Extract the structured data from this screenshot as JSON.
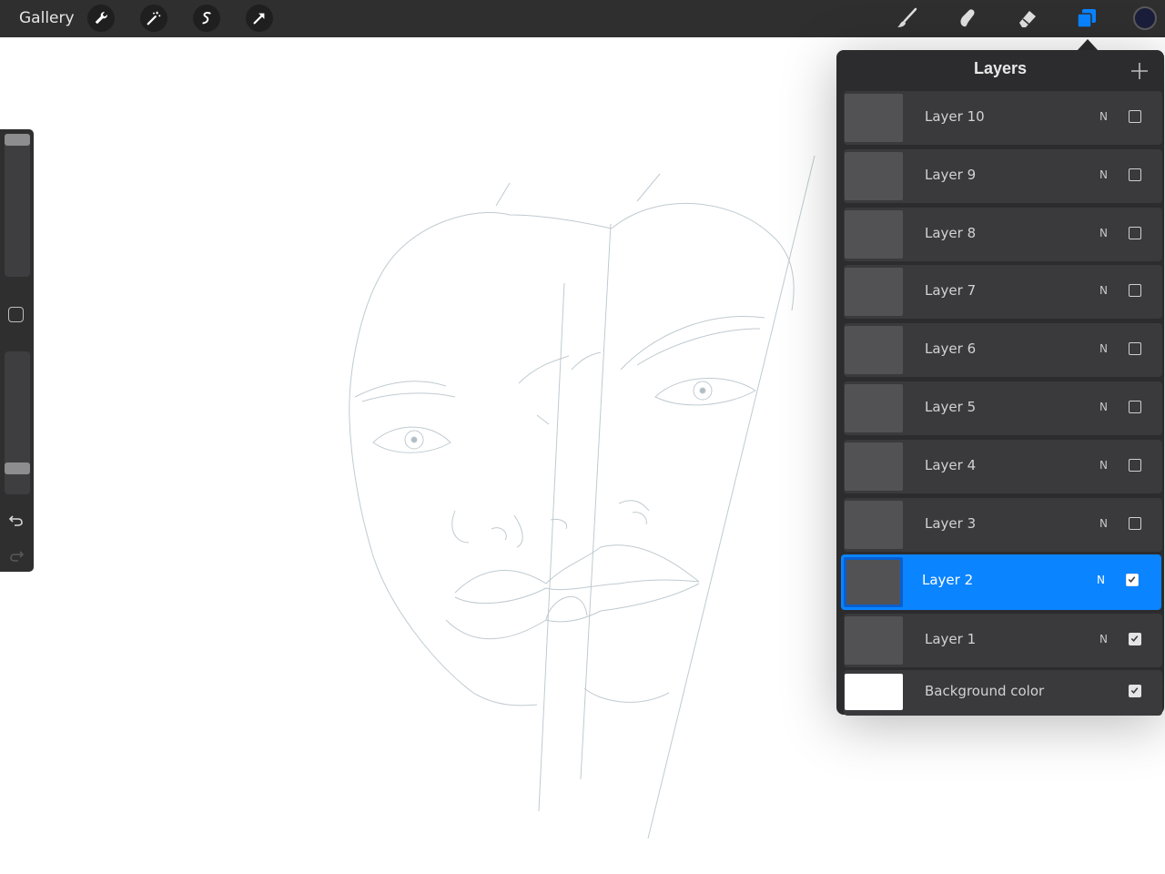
{
  "toolbar": {
    "gallery_label": "Gallery",
    "left_tools": [
      "wrench-icon",
      "magic-wand-icon",
      "selection-s-icon",
      "transform-arrow-icon"
    ],
    "right_tools": [
      "brush-icon",
      "smudge-icon",
      "eraser-icon",
      "layers-icon"
    ],
    "current_color": "#1b1e3a"
  },
  "colors": {
    "accent": "#0a84ff",
    "panel": "#2c2c2e",
    "toolbar": "#2f2f30"
  },
  "sidebar": {
    "brush_size_level": 0.0,
    "opacity_level": 0.85
  },
  "layers_panel": {
    "title": "Layers",
    "layers": [
      {
        "name": "Layer 10",
        "blend": "N",
        "visible": false,
        "active": false
      },
      {
        "name": "Layer 9",
        "blend": "N",
        "visible": false,
        "active": false
      },
      {
        "name": "Layer 8",
        "blend": "N",
        "visible": false,
        "active": false
      },
      {
        "name": "Layer 7",
        "blend": "N",
        "visible": false,
        "active": false
      },
      {
        "name": "Layer 6",
        "blend": "N",
        "visible": false,
        "active": false
      },
      {
        "name": "Layer 5",
        "blend": "N",
        "visible": false,
        "active": false
      },
      {
        "name": "Layer 4",
        "blend": "N",
        "visible": false,
        "active": false
      },
      {
        "name": "Layer 3",
        "blend": "N",
        "visible": false,
        "active": false
      },
      {
        "name": "Layer 2",
        "blend": "N",
        "visible": true,
        "active": true
      },
      {
        "name": "Layer 1",
        "blend": "N",
        "visible": true,
        "active": false
      }
    ],
    "background": {
      "name": "Background color",
      "visible": true
    }
  }
}
